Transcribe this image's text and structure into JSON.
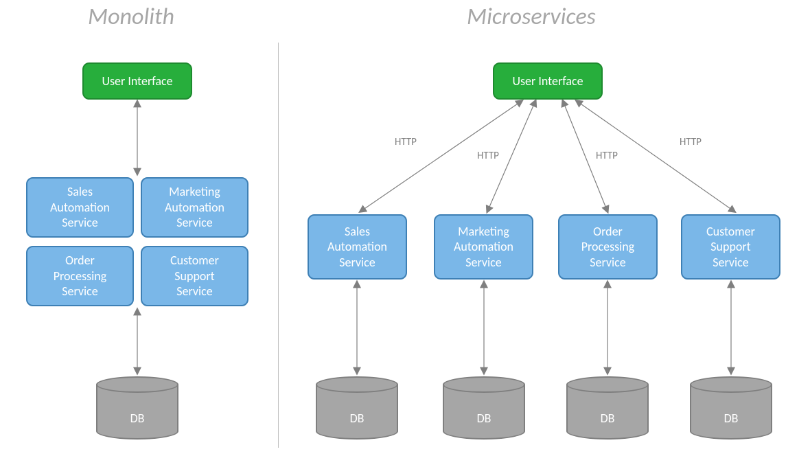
{
  "titles": {
    "monolith": "Monolith",
    "microservices": "Microservices"
  },
  "ui_label": "User Interface",
  "db_label": "DB",
  "http_label": "HTTP",
  "monolith_services": {
    "sales": "Sales\nAutomation\nService",
    "marketing": "Marketing\nAutomation\nService",
    "order": "Order\nProcessing\nService",
    "support": "Customer\nSupport\nService"
  },
  "micro_services": {
    "sales": "Sales\nAutomation\nService",
    "marketing": "Marketing\nAutomation\nService",
    "order": "Order\nProcessing\nService",
    "support": "Customer\nSupport\nService"
  }
}
